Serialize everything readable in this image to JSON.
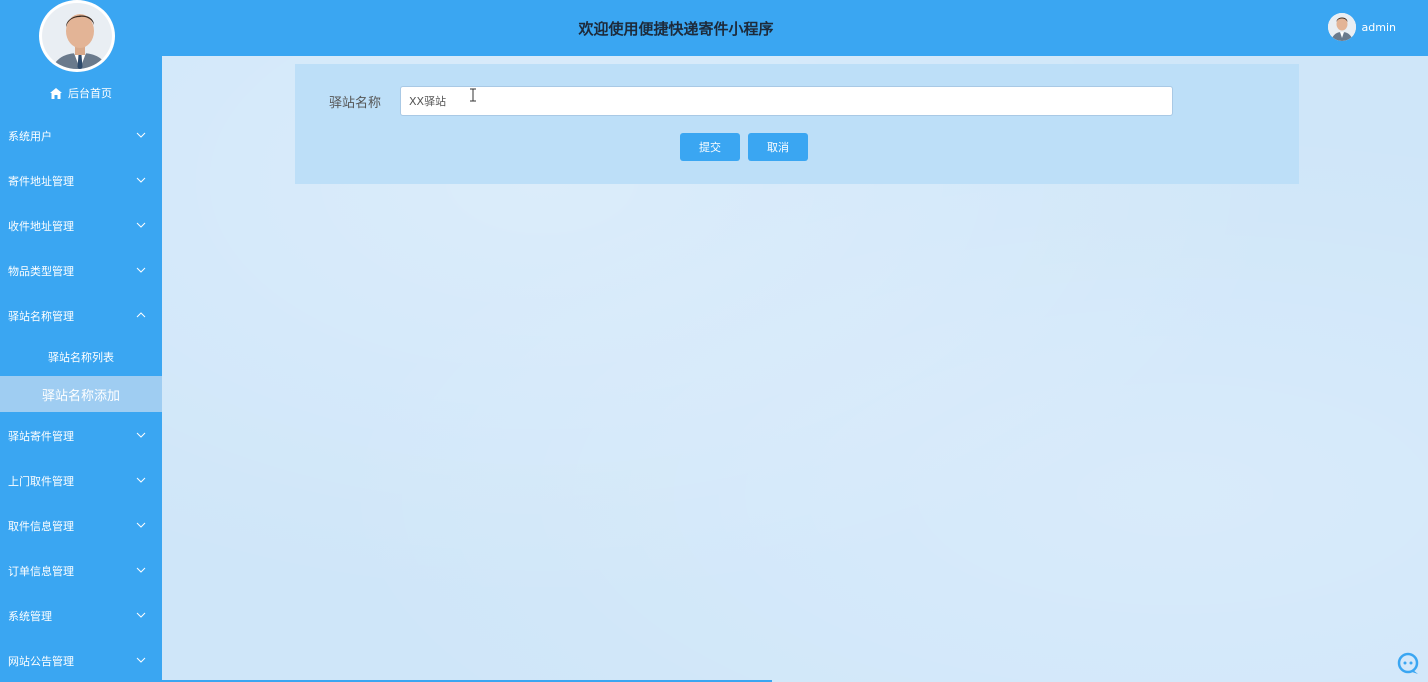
{
  "header": {
    "title": "欢迎使用便捷快递寄件小程序",
    "username": "admin"
  },
  "sidebar": {
    "home_label": "后台首页",
    "items": [
      {
        "label": "系统用户",
        "expanded": false
      },
      {
        "label": "寄件地址管理",
        "expanded": false
      },
      {
        "label": "收件地址管理",
        "expanded": false
      },
      {
        "label": "物品类型管理",
        "expanded": false
      },
      {
        "label": "驿站名称管理",
        "expanded": true
      },
      {
        "label": "驿站寄件管理",
        "expanded": false
      },
      {
        "label": "上门取件管理",
        "expanded": false
      },
      {
        "label": "取件信息管理",
        "expanded": false
      },
      {
        "label": "订单信息管理",
        "expanded": false
      },
      {
        "label": "系统管理",
        "expanded": false
      },
      {
        "label": "网站公告管理",
        "expanded": false
      }
    ],
    "submenu": [
      {
        "label": "驿站名称列表",
        "active": false
      },
      {
        "label": "驿站名称添加",
        "active": true
      }
    ]
  },
  "form": {
    "station_name_label": "驿站名称",
    "station_name_value": "XX驿站",
    "submit_label": "提交",
    "cancel_label": "取消"
  },
  "colors": {
    "primary": "#3aa6f2",
    "content_bg": "#cfe6f9",
    "active_submenu": "#9fcdf2"
  }
}
